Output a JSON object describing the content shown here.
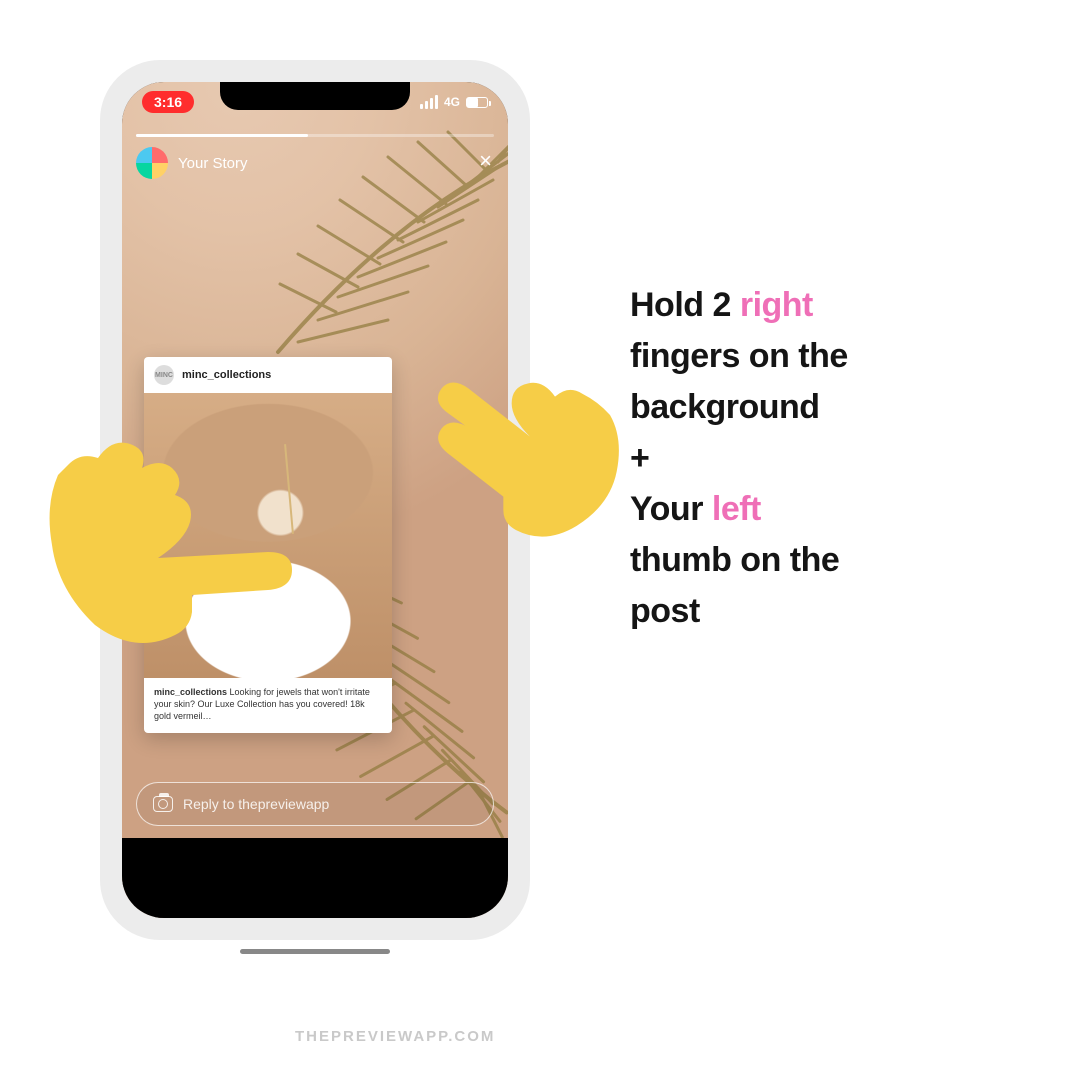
{
  "statusbar": {
    "time": "3:16",
    "network_label": "4G"
  },
  "story": {
    "header_label": "Your Story",
    "reply_placeholder": "Reply to thepreviewapp"
  },
  "post": {
    "avatar_initials": "MINC",
    "username_header": "minc_collections",
    "caption_username": "minc_collections",
    "caption_text": "Looking for jewels that won't irritate your skin? Our Luxe Collection has you covered! 18k gold vermeil…"
  },
  "instructions": {
    "l1a": "Hold 2 ",
    "l1b": "right",
    "l2": "fingers on the",
    "l3": "background",
    "l4": "+",
    "l5a": "Your ",
    "l5b": "left",
    "l6": "thumb on the",
    "l7": "post"
  },
  "watermark": "THEPREVIEWAPP.COM",
  "colors": {
    "accent_pink": "#ef6fb7",
    "emoji_yellow": "#f6cd47",
    "time_pill_red": "#ff2d2d"
  }
}
